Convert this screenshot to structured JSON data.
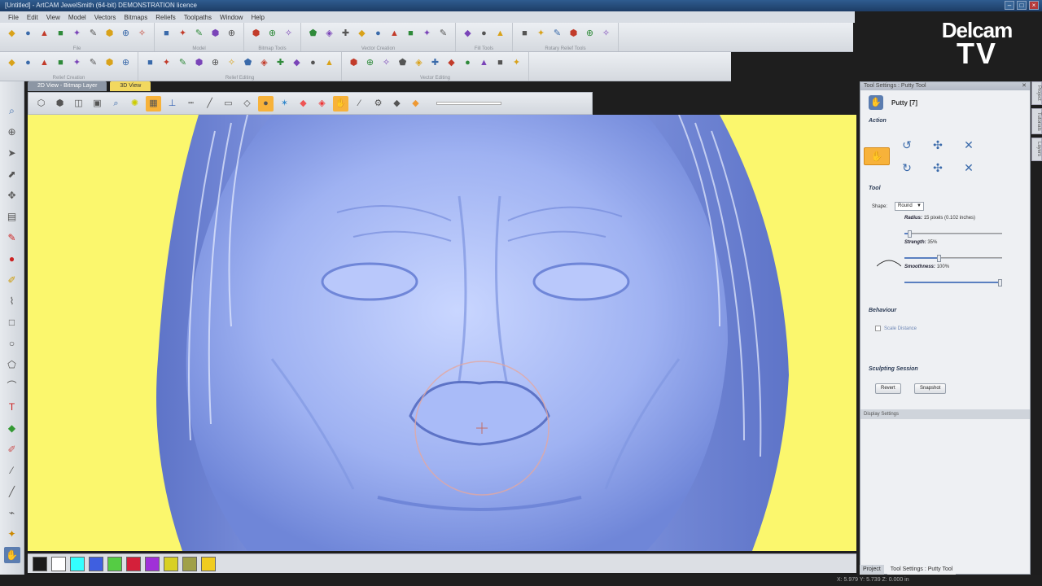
{
  "window": {
    "title": "[Untitled] - ArtCAM JewelSmith (64-bit) DEMONSTRATION licence"
  },
  "menu": [
    "File",
    "Edit",
    "View",
    "Model",
    "Vectors",
    "Bitmaps",
    "Reliefs",
    "Toolpaths",
    "Window",
    "Help"
  ],
  "toolbar_groups_row1": [
    {
      "label": "File",
      "icons": [
        "new-icon",
        "open-icon",
        "save-icon",
        "cut-icon",
        "copy-icon",
        "paste-icon",
        "undo-icon",
        "redo-icon",
        "draw-icon"
      ]
    },
    {
      "label": "Model",
      "icons": [
        "relief-icon",
        "relief-alt-icon",
        "grid-icon",
        "pin-icon",
        "globe-icon"
      ]
    },
    {
      "label": "Bitmap Tools",
      "icons": [
        "bitmap-1-icon",
        "bitmap-2-icon",
        "bitmap-3-icon"
      ]
    },
    {
      "label": "Vector Creation",
      "icons": [
        "vector-1-icon",
        "vector-2-icon",
        "vector-3-icon",
        "vector-4-icon",
        "vector-5-icon",
        "vector-6-icon",
        "vector-7-icon",
        "vector-8-icon",
        "vector-9-icon"
      ]
    },
    {
      "label": "Fill Tools",
      "icons": [
        "fill-1-icon",
        "fill-2-icon",
        "fill-3-icon"
      ]
    },
    {
      "label": "Rotary Relief Tools",
      "icons": [
        "rotary-1-icon",
        "rotary-2-icon",
        "rotary-3-icon",
        "rotary-4-icon",
        "rotary-5-icon",
        "rotary-6-icon"
      ]
    }
  ],
  "toolbar_groups_row2": [
    {
      "label": "Relief Creation",
      "icons": [
        "create-1-icon",
        "create-2-icon",
        "create-3-icon",
        "create-4-icon",
        "create-5-icon",
        "create-6-icon",
        "create-7-icon",
        "create-8-icon"
      ]
    },
    {
      "label": "Relief Editing",
      "icons": [
        "edit-1-icon",
        "edit-2-icon",
        "edit-3-icon",
        "edit-4-icon",
        "edit-5-icon",
        "edit-6-icon",
        "edit-7-icon",
        "edit-8-icon",
        "edit-9-icon",
        "edit-10-icon",
        "edit-11-icon",
        "edit-12-icon"
      ]
    },
    {
      "label": "Vector Editing",
      "icons": [
        "vedit-1-icon",
        "vedit-2-icon",
        "vedit-3-icon",
        "vedit-4-icon",
        "vedit-5-icon",
        "vedit-6-icon",
        "vedit-7-icon",
        "vedit-8-icon",
        "vedit-9-icon",
        "vedit-10-icon",
        "vedit-11-icon"
      ]
    }
  ],
  "view_tabs": [
    {
      "label": "2D View - Bitmap Layer",
      "active": false
    },
    {
      "label": "3D View",
      "active": true
    }
  ],
  "logo": {
    "line1": "Delcam",
    "line2": "TV"
  },
  "panel": {
    "title": "Tool Settings : Putty Tool",
    "tool_name": "Putty [7]",
    "action_heading": "Action",
    "tool_heading": "Tool",
    "shape_label": "Shape:",
    "shape_value": "Round",
    "radius_label": "Radius:",
    "radius_value": "15 pixels (0.102 inches)",
    "strength_label": "Strength:",
    "strength_value": "35%",
    "smoothness_label": "Smoothness:",
    "smoothness_value": "100%",
    "radius_fraction": 0.05,
    "strength_fraction": 0.35,
    "smoothness_fraction": 1.0,
    "behaviour_heading": "Behaviour",
    "scale_label": "Scale Distance",
    "session_heading": "Sculpting Session",
    "revert_label": "Revert",
    "snapshot_label": "Snapshot",
    "display_settings_label": "Display Settings"
  },
  "bottom_tabs": [
    {
      "label": "Project",
      "active": false
    },
    {
      "label": "Tool Settings : Putty Tool",
      "active": true
    }
  ],
  "side_tabs": [
    "Project",
    "Tutorials",
    "Layers"
  ],
  "colors": {
    "viewport_background": "#fbf76d",
    "relief": "#9fb2f2",
    "accent": "#f7b23a"
  },
  "palette": [
    "#1a1a1a",
    "#ffffff",
    "#33ffff",
    "#3f5fe0",
    "#55cc44",
    "#d4203a",
    "#a030d8",
    "#d8d024",
    "#a0a048",
    "#f0cc20"
  ],
  "status": {
    "coords": "X: 5.979   Y: 5.739   Z: 0.000 in"
  }
}
